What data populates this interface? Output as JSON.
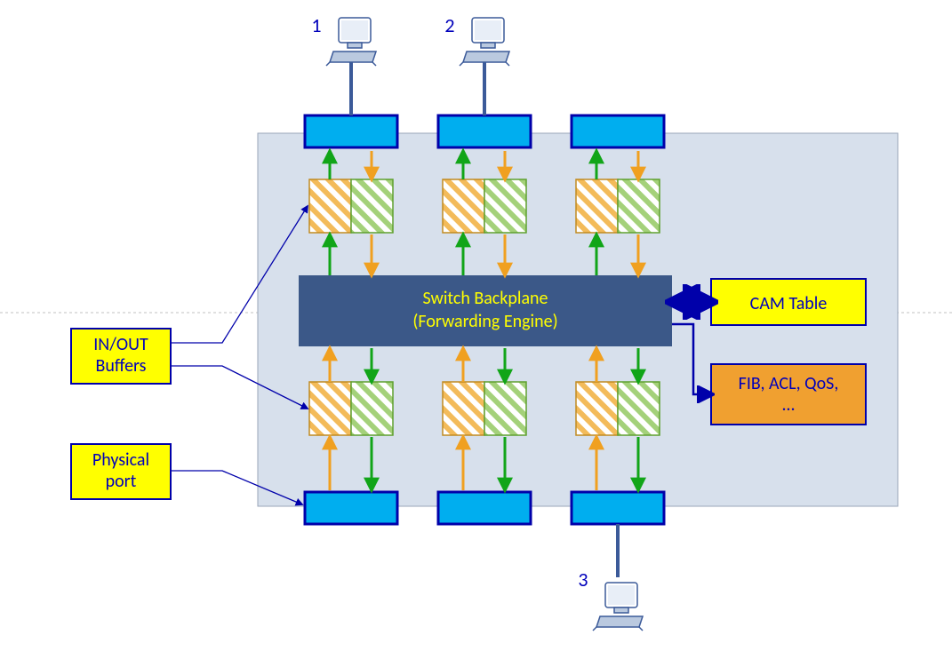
{
  "computers": {
    "top_left": "1",
    "top_right": "2",
    "bottom": "3"
  },
  "labels": {
    "inout": {
      "line1": "IN/OUT",
      "line2": "Buffers"
    },
    "port": {
      "line1": "Physical",
      "line2": "port"
    }
  },
  "backplane": {
    "line1": "Switch Backplane",
    "line2": "(Forwarding Engine)"
  },
  "side": {
    "cam": "CAM Table",
    "extra": {
      "line1": "FIB, ACL, QoS,",
      "line2": "…"
    }
  },
  "colors": {
    "chassis": "#d7e0ec",
    "backplane": "#3b5888",
    "port_fill": "#00aeef",
    "port_stroke": "#0000AA",
    "accent_yellow": "#ffff00",
    "accent_orange": "#f0a030",
    "arrow_green": "#11a518",
    "arrow_orange": "#f0a020",
    "text_blue": "#0000BB"
  }
}
